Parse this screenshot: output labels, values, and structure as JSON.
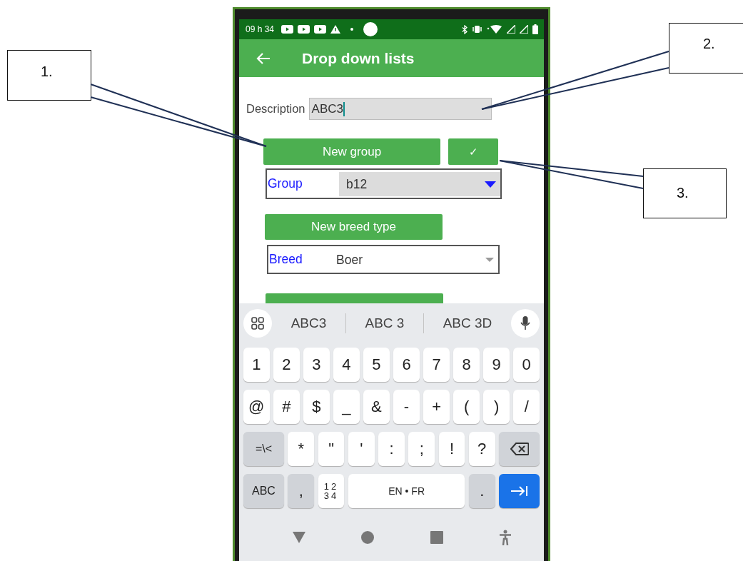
{
  "status_bar": {
    "time": "09 h 34"
  },
  "app_bar": {
    "title": "Drop down lists"
  },
  "form": {
    "description": {
      "label": "Description",
      "value": "ABC3"
    },
    "new_group_button": "New group",
    "confirm_button": "✓",
    "group_dropdown": {
      "label": "Group",
      "value": "b12",
      "active": true
    },
    "new_breed_button": "New breed type",
    "breed_dropdown": {
      "label": "Breed",
      "value": "Boer",
      "active": false
    },
    "covered_button": {
      "kind": "button"
    }
  },
  "keyboard": {
    "suggestions": [
      "ABC3",
      "ABC 3",
      "ABC 3D"
    ],
    "key_rows": [
      {
        "keys": [
          {
            "label": "1",
            "kind": "char"
          },
          {
            "label": "2",
            "kind": "char"
          },
          {
            "label": "3",
            "kind": "char"
          },
          {
            "label": "4",
            "kind": "char"
          },
          {
            "label": "5",
            "kind": "char"
          },
          {
            "label": "6",
            "kind": "char"
          },
          {
            "label": "7",
            "kind": "char"
          },
          {
            "label": "8",
            "kind": "char"
          },
          {
            "label": "9",
            "kind": "char"
          },
          {
            "label": "0",
            "kind": "char"
          }
        ]
      },
      {
        "keys": [
          {
            "label": "@",
            "kind": "char"
          },
          {
            "label": "#",
            "kind": "char"
          },
          {
            "label": "$",
            "kind": "char"
          },
          {
            "label": "_",
            "kind": "char"
          },
          {
            "label": "&",
            "kind": "char"
          },
          {
            "label": "-",
            "kind": "char"
          },
          {
            "label": "+",
            "kind": "char"
          },
          {
            "label": "(",
            "kind": "char"
          },
          {
            "label": ")",
            "kind": "char"
          },
          {
            "label": "/",
            "kind": "char"
          }
        ]
      },
      {
        "keys": [
          {
            "label": "=\\<",
            "kind": "wide-mod"
          },
          {
            "label": "*",
            "kind": "char"
          },
          {
            "label": "\"",
            "kind": "char"
          },
          {
            "label": "'",
            "kind": "char"
          },
          {
            "label": ":",
            "kind": "char"
          },
          {
            "label": ";",
            "kind": "char"
          },
          {
            "label": "!",
            "kind": "char"
          },
          {
            "label": "?",
            "kind": "char"
          },
          {
            "kind": "backspace"
          }
        ]
      },
      {
        "keys": [
          {
            "label": "ABC",
            "kind": "wide-mod"
          },
          {
            "label": ",",
            "kind": "mod"
          },
          {
            "lines": [
              "12",
              "34"
            ],
            "kind": "numpad"
          },
          {
            "label": "EN • FR",
            "kind": "space"
          },
          {
            "label": ".",
            "kind": "mod"
          },
          {
            "kind": "enter"
          }
        ]
      }
    ]
  },
  "callouts": [
    {
      "label": "1."
    },
    {
      "label": "2."
    },
    {
      "label": "3."
    }
  ]
}
